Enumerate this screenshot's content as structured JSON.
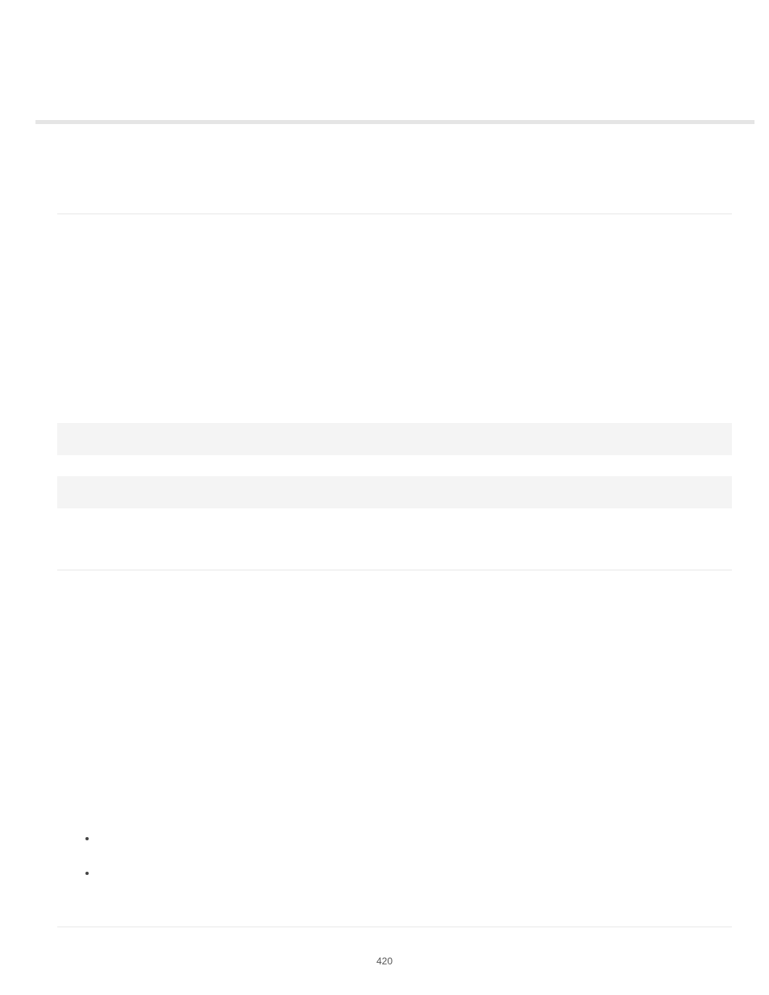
{
  "page_number": "420"
}
